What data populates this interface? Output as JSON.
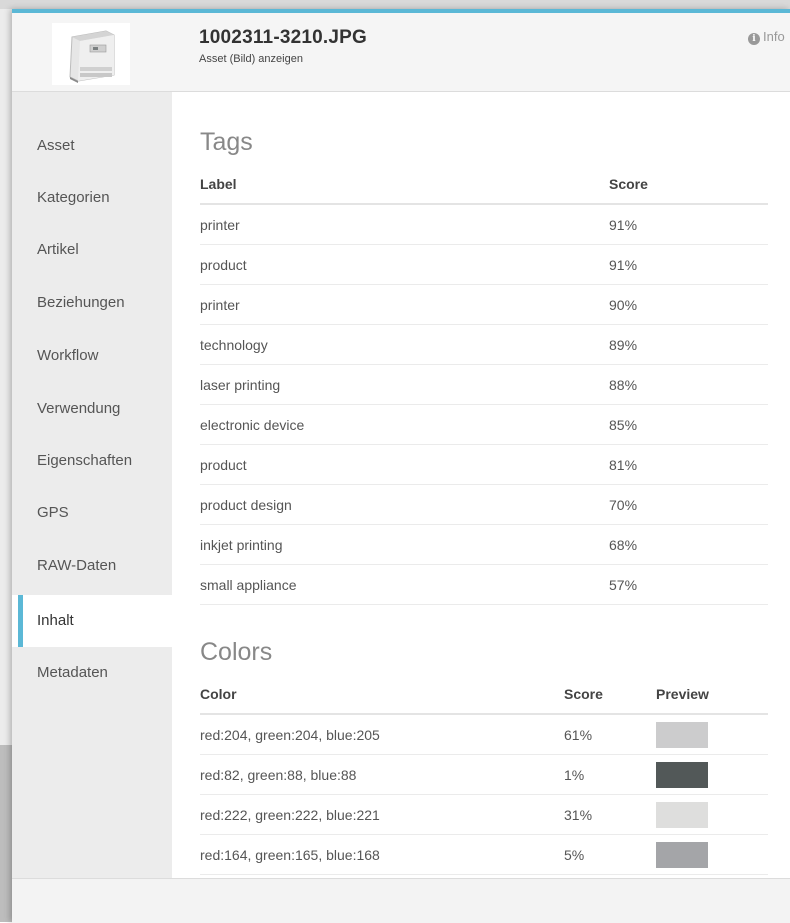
{
  "header": {
    "title": "1002311-3210.JPG",
    "subtitle": "Asset (Bild) anzeigen",
    "info_label": "Info",
    "accent_color": "#5bb8d6"
  },
  "sidebar": {
    "items": [
      {
        "label": "Asset"
      },
      {
        "label": "Kategorien"
      },
      {
        "label": "Artikel"
      },
      {
        "label": "Beziehungen"
      },
      {
        "label": "Workflow"
      },
      {
        "label": "Verwendung"
      },
      {
        "label": "Eigenschaften"
      },
      {
        "label": "GPS"
      },
      {
        "label": "RAW-Daten"
      },
      {
        "label": "Inhalt"
      },
      {
        "label": "Metadaten"
      }
    ],
    "active_index": 9
  },
  "tags": {
    "title": "Tags",
    "columns": [
      "Label",
      "Score"
    ],
    "rows": [
      {
        "label": "printer",
        "score": "91%"
      },
      {
        "label": "product",
        "score": "91%"
      },
      {
        "label": "printer",
        "score": "90%"
      },
      {
        "label": "technology",
        "score": "89%"
      },
      {
        "label": "laser printing",
        "score": "88%"
      },
      {
        "label": "electronic device",
        "score": "85%"
      },
      {
        "label": "product",
        "score": "81%"
      },
      {
        "label": "product design",
        "score": "70%"
      },
      {
        "label": "inkjet printing",
        "score": "68%"
      },
      {
        "label": "small appliance",
        "score": "57%"
      }
    ]
  },
  "colors": {
    "title": "Colors",
    "columns": [
      "Color",
      "Score",
      "Preview"
    ],
    "rows": [
      {
        "color": "red:204, green:204, blue:205",
        "score": "61%",
        "swatch": "#cccccd"
      },
      {
        "color": "red:82, green:88, blue:88",
        "score": "1%",
        "swatch": "#525858"
      },
      {
        "color": "red:222, green:222, blue:221",
        "score": "31%",
        "swatch": "#dededd"
      },
      {
        "color": "red:164, green:165, blue:168",
        "score": "5%",
        "swatch": "#a4a5a8"
      }
    ]
  }
}
